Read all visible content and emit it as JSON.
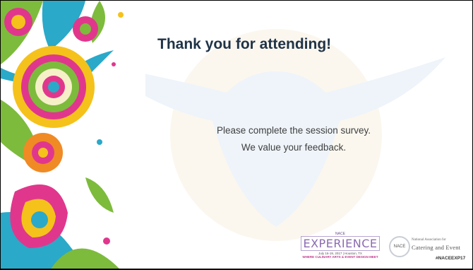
{
  "slide": {
    "title": "Thank you for attending!",
    "body_line1": "Please complete the session survey.",
    "body_line2": "We value your feedback."
  },
  "logos": {
    "experience": {
      "brand": "NACE",
      "word": "EXPERIENCE",
      "dates": "July 16-19, 2017 | Houston, TX",
      "tagline": "WHERE CULINARY ARTS & EVENT DESIGN MEET"
    },
    "nace": {
      "circle_text": "NACE",
      "line1": "National Association for",
      "line2": "Catering and Event",
      "hashtag": "#NACEEXP17"
    }
  },
  "colors": {
    "title": "#1f3347",
    "body": "#404040",
    "accent_pink": "#e0378d",
    "accent_teal": "#2aa9c9",
    "accent_green": "#7dbb3c",
    "accent_yellow": "#f5c21b"
  }
}
